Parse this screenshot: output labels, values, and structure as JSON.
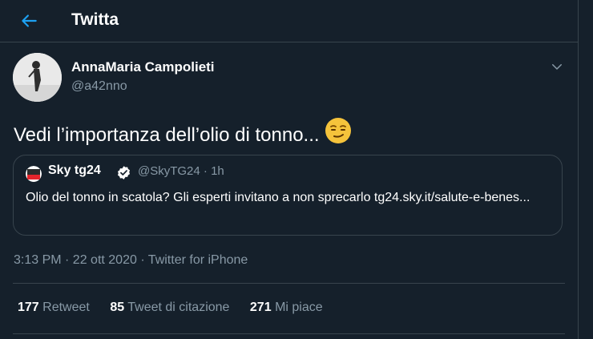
{
  "header": {
    "title": "Twitta",
    "back_icon": "arrow-left-icon"
  },
  "tweet": {
    "author_name": "AnnaMaria Campolieti",
    "author_handle": "@a42nno",
    "text": "Vedi l’importanza dell’olio di tonno...",
    "emoji": "smirking-face-emoji",
    "timestamp": "3:13 PM · 22 ott 2020 · Twitter for iPhone"
  },
  "quoted": {
    "author_name": "Sky tg24",
    "author_handle_time": "@SkyTG24 · 1h",
    "text": "Olio del tonno in scatola? Gli esperti invitano a non sprecarlo tg24.sky.it/salute-e-benes..."
  },
  "stats": {
    "retweets_count": "177",
    "retweets_label": "Retweet",
    "quotes_count": "85",
    "quotes_label": "Tweet di citazione",
    "likes_count": "271",
    "likes_label": "Mi piace"
  },
  "colors": {
    "background": "#15202b",
    "accent": "#1da1f2",
    "muted": "#8899a6",
    "border": "#38444d"
  }
}
